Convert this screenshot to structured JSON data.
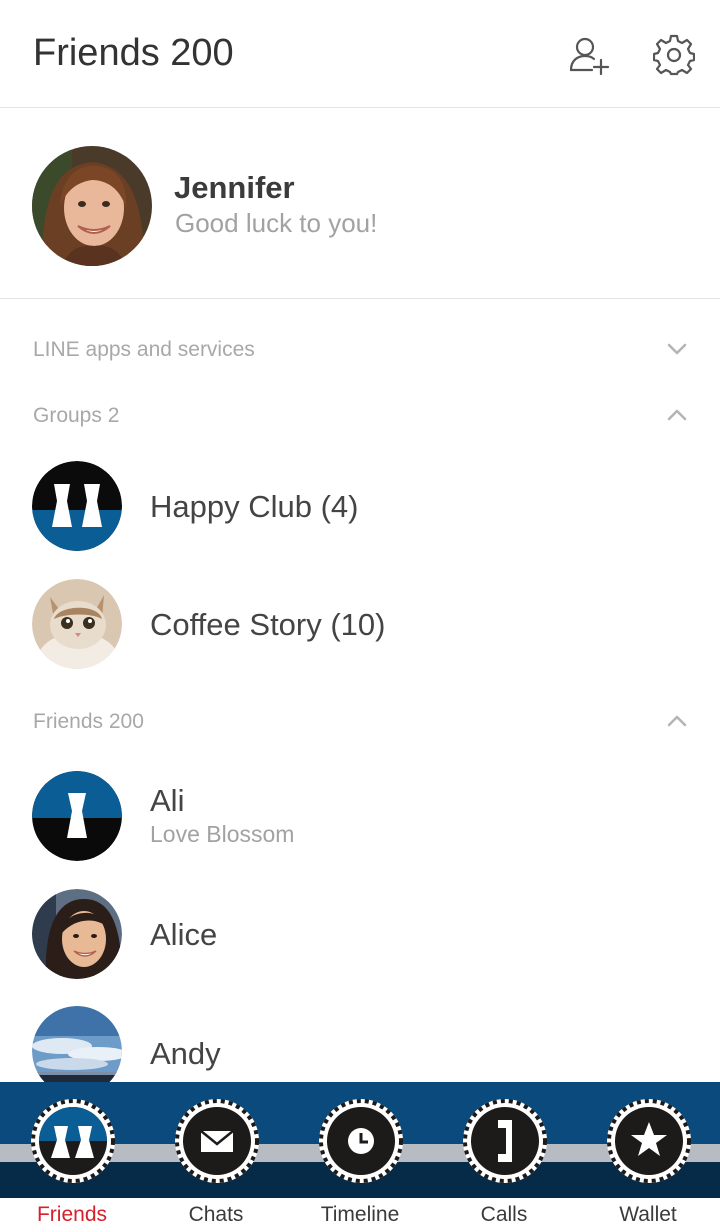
{
  "header": {
    "title": "Friends 200",
    "add_friend_icon": "add-friend-icon",
    "settings_icon": "gear-icon"
  },
  "profile": {
    "name": "Jennifer",
    "status": "Good luck to you!"
  },
  "sections": {
    "services": {
      "label": "LINE apps and services",
      "expanded": false
    },
    "groups": {
      "label": "Groups 2",
      "expanded": true
    },
    "friends": {
      "label": "Friends 200",
      "expanded": true
    }
  },
  "groups": [
    {
      "name": "Happy Club (4)"
    },
    {
      "name": "Coffee Story (10)"
    }
  ],
  "friends": [
    {
      "name": "Ali",
      "status": "Love Blossom"
    },
    {
      "name": "Alice",
      "status": ""
    },
    {
      "name": "Andy",
      "status": ""
    }
  ],
  "tabs": [
    {
      "label": "Friends",
      "icon": "friends-icon",
      "active": true
    },
    {
      "label": "Chats",
      "icon": "chat-icon",
      "active": false
    },
    {
      "label": "Timeline",
      "icon": "clock-icon",
      "active": false
    },
    {
      "label": "Calls",
      "icon": "phone-icon",
      "active": false
    },
    {
      "label": "Wallet",
      "icon": "star-icon",
      "active": false
    }
  ],
  "colors": {
    "accent": "#d6202c",
    "theme_blue": "#0b4a7c",
    "theme_dark": "#1d1a1a",
    "stripe": "#b6bcc2"
  }
}
